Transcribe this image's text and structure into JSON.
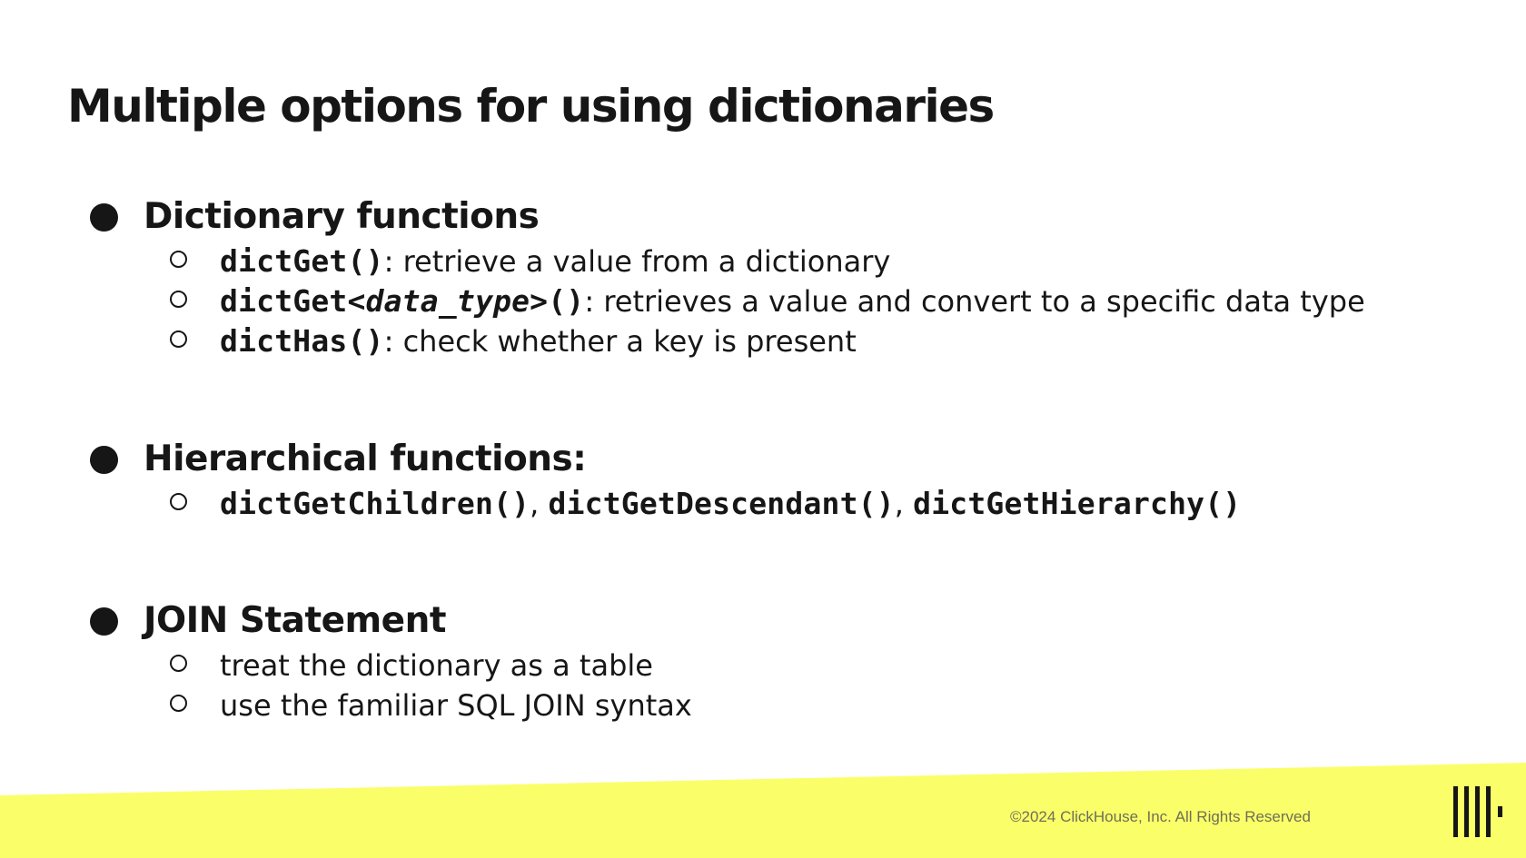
{
  "slide": {
    "title": "Multiple options for using dictionaries"
  },
  "sections": [
    {
      "heading": "Dictionary functions",
      "items": [
        {
          "code": "dictGet()",
          "text": ": retrieve a value from a dictionary"
        },
        {
          "code_prefix": "dictGet<",
          "code_italic": "data_type",
          "code_suffix": ">()",
          "text": ": retrieves a value and convert to a specific data type"
        },
        {
          "code": "dictHas()",
          "text": ": check whether a key is present"
        }
      ]
    },
    {
      "heading": "Hierarchical functions:",
      "items": [
        {
          "code_1": "dictGetChildren()",
          "sep_1": ", ",
          "code_2": "dictGetDescendant()",
          "sep_2": ", ",
          "code_3": "dictGetHierarchy()"
        }
      ]
    },
    {
      "heading": "JOIN Statement",
      "items": [
        {
          "text": "treat the dictionary as a table"
        },
        {
          "text": "use the familiar SQL JOIN syntax"
        }
      ]
    }
  ],
  "footer": {
    "copyright": "©2024 ClickHouse, Inc. All Rights Reserved",
    "band_color": "#faff69",
    "logo_icon": "clickhouse-logo-icon"
  }
}
